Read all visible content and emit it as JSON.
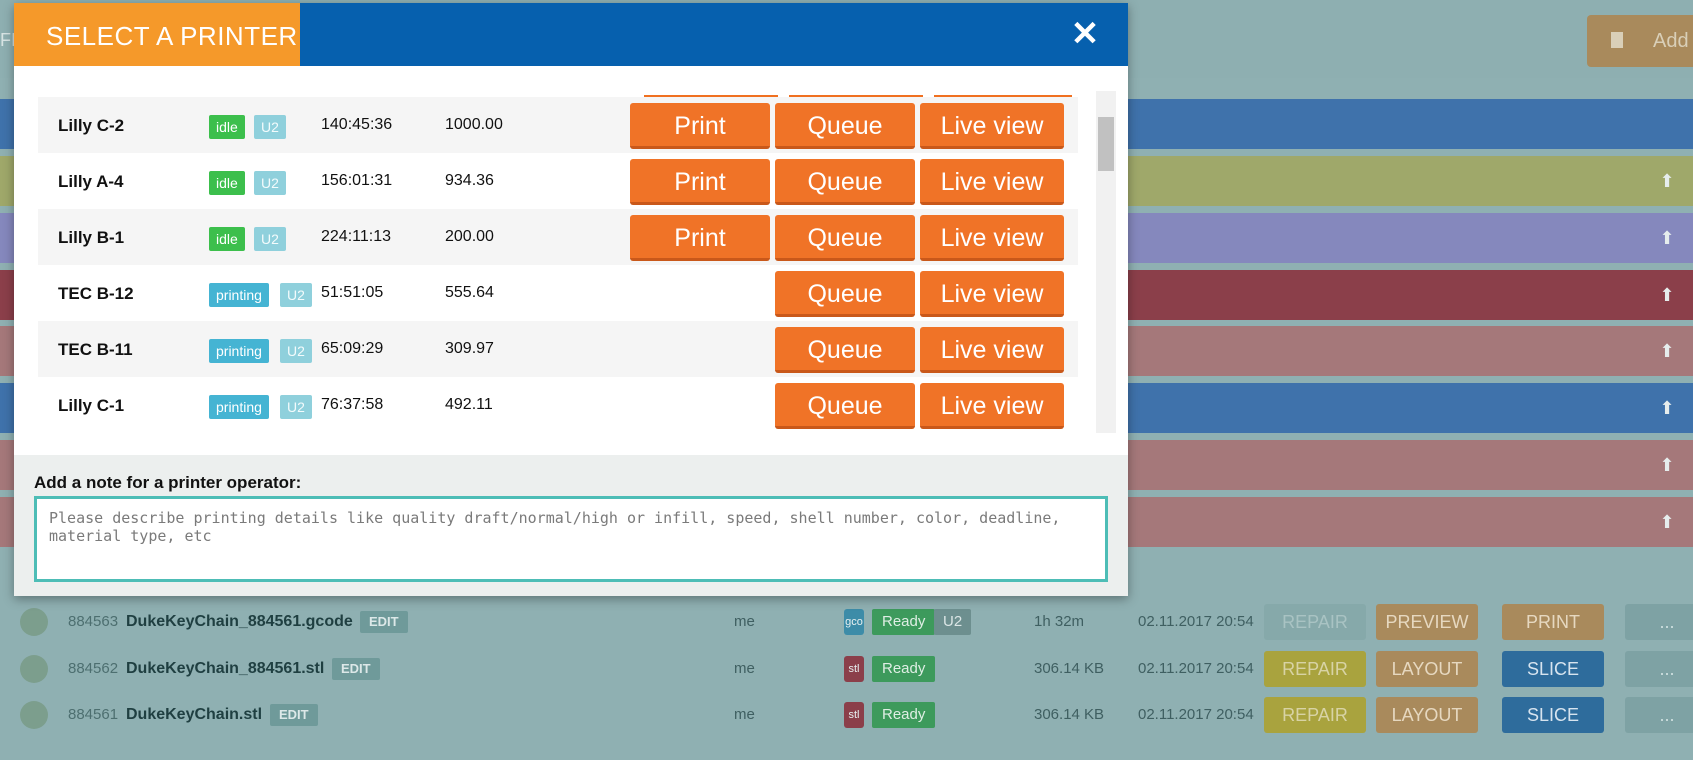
{
  "background": {
    "top_left_fragment": "FI",
    "add_button_label": "Add",
    "stripes": [
      {
        "color": "#3f72ab"
      },
      {
        "color": "#9fa86a"
      },
      {
        "color": "#8588bd"
      },
      {
        "color": "#8b3f4a"
      },
      {
        "color": "#a5787a"
      },
      {
        "color": "#3f72ab"
      },
      {
        "color": "#a5787a"
      },
      {
        "color": "#a5787a"
      }
    ],
    "files": [
      {
        "id": "884563",
        "name": "DukeKeyChain_884561.gcode",
        "edit": "EDIT",
        "owner": "me",
        "type": "gco",
        "status": "Ready",
        "printer": "U2",
        "size": "1h 32m",
        "date": "02.11.2017 20:54",
        "actions": [
          "REPAIR",
          "PREVIEW",
          "PRINT"
        ],
        "more": "..."
      },
      {
        "id": "884562",
        "name": "DukeKeyChain_884561.stl",
        "edit": "EDIT",
        "owner": "me",
        "type": "stl",
        "status": "Ready",
        "printer": "",
        "size": "306.14 KB",
        "date": "02.11.2017 20:54",
        "actions": [
          "REPAIR",
          "LAYOUT",
          "SLICE"
        ],
        "more": "..."
      },
      {
        "id": "884561",
        "name": "DukeKeyChain.stl",
        "edit": "EDIT",
        "owner": "me",
        "type": "stl",
        "status": "Ready",
        "printer": "",
        "size": "306.14 KB",
        "date": "02.11.2017 20:54",
        "actions": [
          "REPAIR",
          "LAYOUT",
          "SLICE"
        ],
        "more": "..."
      }
    ]
  },
  "modal": {
    "title": "SELECT A PRINTER",
    "close_icon": "close-icon",
    "buttons": {
      "print": "Print",
      "queue": "Queue",
      "live": "Live view"
    },
    "printers": [
      {
        "name": "Lilly C-2",
        "status": "idle",
        "model": "U2",
        "time": "140:45:36",
        "value": "1000.00",
        "can_print": true
      },
      {
        "name": "Lilly A-4",
        "status": "idle",
        "model": "U2",
        "time": "156:01:31",
        "value": "934.36",
        "can_print": true
      },
      {
        "name": "Lilly B-1",
        "status": "idle",
        "model": "U2",
        "time": "224:11:13",
        "value": "200.00",
        "can_print": true
      },
      {
        "name": "TEC B-12",
        "status": "printing",
        "model": "U2",
        "time": "51:51:05",
        "value": "555.64",
        "can_print": false
      },
      {
        "name": "TEC B-11",
        "status": "printing",
        "model": "U2",
        "time": "65:09:29",
        "value": "309.97",
        "can_print": false
      },
      {
        "name": "Lilly C-1",
        "status": "printing",
        "model": "U2",
        "time": "76:37:58",
        "value": "492.11",
        "can_print": false
      }
    ],
    "note": {
      "label": "Add a note for a printer operator:",
      "placeholder": "Please describe printing details like quality draft/normal/high or infill, speed, shell number, color, deadline, material type, etc"
    },
    "colors": {
      "accent_orange": "#f07327",
      "header_blue": "#0660ae",
      "title_orange": "#f5992a",
      "idle_green": "#3cbf4c",
      "printing_blue": "#45b4d3"
    }
  }
}
